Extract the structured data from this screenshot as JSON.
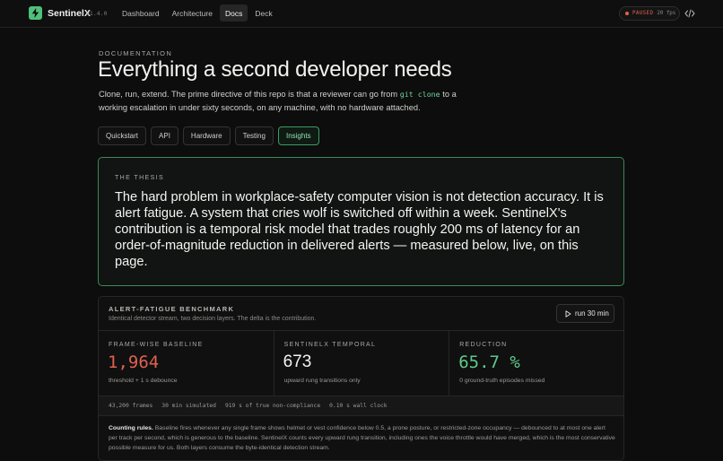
{
  "header": {
    "brand": "SentinelX",
    "version": "v1.4.0",
    "nav": [
      {
        "label": "Dashboard",
        "active": false
      },
      {
        "label": "Architecture",
        "active": false
      },
      {
        "label": "Docs",
        "active": true
      },
      {
        "label": "Deck",
        "active": false
      }
    ],
    "status": {
      "label": "PAUSED",
      "fps": "20 fps",
      "color": "#e0614f"
    },
    "code_icon": "code-icon"
  },
  "page": {
    "eyebrow": "DOCUMENTATION",
    "title": "Everything a second developer needs",
    "lead_before": "Clone, run, extend. The prime directive of this repo is that a reviewer can go from ",
    "lead_code": "git clone",
    "lead_after": " to a working escalation in under sixty seconds, on any machine, with no hardware attached.",
    "tabs": [
      {
        "label": "Quickstart",
        "active": false
      },
      {
        "label": "API",
        "active": false
      },
      {
        "label": "Hardware",
        "active": false
      },
      {
        "label": "Testing",
        "active": false
      },
      {
        "label": "Insights",
        "active": true
      }
    ]
  },
  "thesis": {
    "label": "THE THESIS",
    "text": "The hard problem in workplace-safety computer vision is not detection accuracy. It is alert fatigue. A system that cries wolf is switched off within a week. SentinelX's contribution is a temporal risk model that trades roughly 200 ms of latency for an order-of-magnitude reduction in delivered alerts — measured below, live, on this page."
  },
  "benchmark": {
    "title": "ALERT-FATIGUE BENCHMARK",
    "subtitle": "Identical detector stream, two decision layers. The delta is the contribution.",
    "run_label": "run 30 min",
    "stats": [
      {
        "label": "FRAME-WISE BASELINE",
        "value": "1,964",
        "note": "threshold + 1 s debounce",
        "color": "#e0614f"
      },
      {
        "label": "SENTINELX TEMPORAL",
        "value": "673",
        "note": "upward rung transitions only",
        "color": "#f2f2f0"
      },
      {
        "label": "REDUCTION",
        "value": "65.7 %",
        "note": "0 ground-truth episodes missed",
        "color": "#5fc98a"
      }
    ],
    "meta": [
      "43,200 frames",
      "30 min simulated",
      "919 s of true non-compliance",
      "0.10 s wall clock"
    ],
    "counting_title": "Counting rules.",
    "counting_text": " Baseline fires whenever any single frame shows helmet or vest confidence below 0.5, a prone posture, or restricted-zone occupancy — debounced to at most one alert per track per second, which is generous to the baseline. SentinelX counts every upward rung transition, including ones the voice throttle would have merged, which is the most conservative possible measure for us. Both layers consume the byte-identical detection stream."
  }
}
